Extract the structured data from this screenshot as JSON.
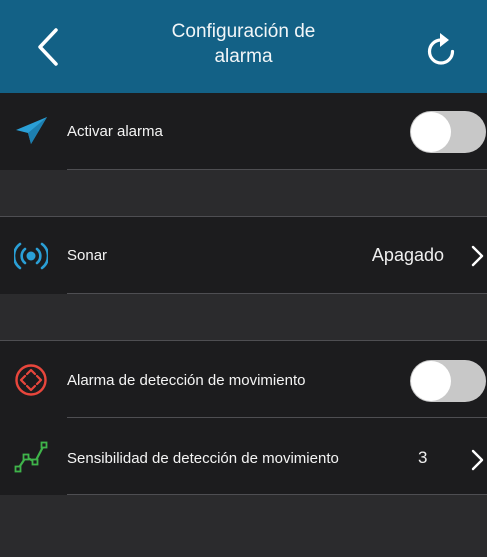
{
  "header": {
    "title_line1": "Configuración de",
    "title_line2": "alarma",
    "back_icon": "chevron-left-icon",
    "refresh_icon": "refresh-icon",
    "background_color": "#136186"
  },
  "settings": {
    "activate_alarm": {
      "label": "Activar alarma",
      "icon": "paper-plane-icon",
      "icon_color": "#2a9fd6",
      "toggle_on": false
    },
    "sonar": {
      "label": "Sonar",
      "value": "Apagado",
      "icon": "sound-waves-icon",
      "icon_color": "#2a9fd6"
    },
    "motion_alarm": {
      "label": "Alarma de detección de movimiento",
      "icon": "motion-target-icon",
      "icon_color": "#e8463c",
      "toggle_on": false
    },
    "motion_sensitivity": {
      "label": "Sensibilidad de detección de movimiento",
      "value": "3",
      "icon": "line-chart-icon",
      "icon_color": "#3fb44a"
    }
  }
}
